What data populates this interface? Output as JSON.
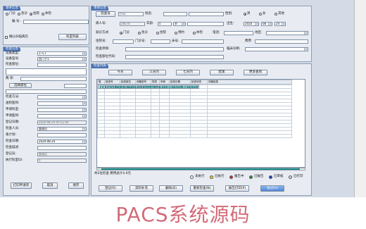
{
  "left": {
    "section1_title": "基本信息",
    "radios": [
      "门诊",
      "急诊",
      "住院",
      "体检"
    ],
    "radio_selected": 2,
    "check_no_label": "编 号:",
    "check_no_value": "",
    "scan_checkbox_label": "确认扫描病历",
    "list_button": "科室列表",
    "section2_title": "检查信息",
    "device_type_label": "设备类型:",
    "device_type_value": "1--CT",
    "device_model_label": "设备型号:",
    "device_model_value": "西门子1",
    "check_part_label": "检查部位:",
    "check_part_value": "",
    "two_label": "两 项:",
    "select_part_button": "选择部位",
    "check_method_label": "检查方法:",
    "send_doctor_label": "送检医师:",
    "apply_dept_label": "申请科室:",
    "apply_doctor_label": "申请医师:",
    "register_date_label": "登记日期:",
    "register_date_value": "2020-08-24 05:52:40",
    "checker_label": "检查人员:",
    "checker_value": "管理员",
    "charge_label": "角计划:",
    "check_date_label": "检查日期:",
    "check_date_value": "2020-08-24",
    "check_remark_label": "检查描述:",
    "recorder_label": "登记员:",
    "recorder_value": "管理员",
    "exec_id_label": "执行科室ID:",
    "exec_id_value": "0",
    "print_button": "打印申请单",
    "cancel_button": "取消",
    "save_button": "保存"
  },
  "patient": {
    "title": "患者信息",
    "check_no_btn": "检查号",
    "check_no_value": "(TS)",
    "name_label": "姓名:",
    "gender_label": "性别:",
    "gender_options": [
      "男",
      "女",
      "其他"
    ],
    "gender_selected": 0,
    "patient_id_label": "病人号:",
    "patient_id_value": "28570",
    "age_label": "年龄:",
    "age_value": "0",
    "age_unit": "岁",
    "birth_label": "出生:",
    "birth_year": "2020",
    "birth_month": "08",
    "birth_day": "24",
    "visit_label": "就诊方式:",
    "visit_options": [
      "门诊",
      "急诊",
      "住院",
      "预约",
      "体检"
    ],
    "visit_selected": 0,
    "phone_label": "电话:",
    "area_label": "地区:",
    "hosp_no_label": "住院号:",
    "outpatient_no_label": "门诊号:",
    "bed_label": "床号:",
    "fee_label": "费用",
    "check_item_label": "检查项目:",
    "clinical_label": "临床诊断:",
    "check_code_label": "检查部位代码:"
  },
  "list": {
    "title": "检查列表",
    "filters": [
      "今天",
      "三天内",
      "七天内",
      "结束",
      "更多查询"
    ],
    "columns": [
      "登",
      "检查号",
      "检查部位",
      "设备型号",
      "性别",
      "年龄",
      "检查日期",
      "检查状态",
      "详细信息"
    ],
    "rows": [
      [
        "普通",
        "8875",
        "CT01",
        "西门子1",
        "男",
        "0",
        "2020-08-24",
        "登记",
        "腹部正中位片,腹部正中位片"
      ],
      [
        "普通",
        "8876",
        "CT01",
        "西门子1",
        "男",
        "0",
        "2020-08-24",
        "登记",
        "腹部正中位片,腹部正中位片"
      ]
    ],
    "summary": "共2位检查  费用总计4.0元",
    "legend": [
      {
        "label": "未执行",
        "color": "#ffffff"
      },
      {
        "label": "已执行",
        "color": "#f1d22a"
      },
      {
        "label": "报告中",
        "color": "#d42b2b"
      },
      {
        "label": "已报告",
        "color": "#2f8a2f"
      },
      {
        "label": "已审核",
        "color": "#1c3fbf"
      },
      {
        "label": "已打印",
        "color": "#d8d8d8"
      }
    ],
    "actions": [
      "登记(R)",
      "资料补充",
      "删除(D)",
      "重新检查(N)",
      "报告打印(P)",
      "登记(U)"
    ]
  },
  "caption": "PACS系统源码"
}
